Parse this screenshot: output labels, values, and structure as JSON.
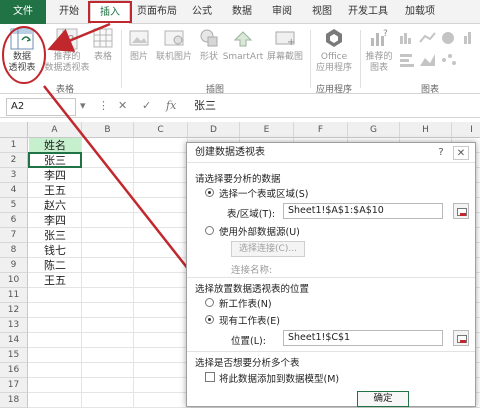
{
  "ribbon": {
    "tabs": [
      "文件",
      "开始",
      "插入",
      "页面布局",
      "公式",
      "数据",
      "审阅",
      "视图",
      "开发工具",
      "加载项"
    ],
    "buttons": {
      "pivot_table": "数据\n透视表",
      "recommended_pivot": "推荐的\n数据透视表",
      "table": "表格",
      "pictures": "图片",
      "online_pictures": "联机图片",
      "shapes": "形状",
      "smartart": "SmartArt",
      "screenshot": "屏幕截图",
      "office_apps": "Office\n应用程序",
      "recommended_charts": "推荐的\n图表"
    },
    "groups": {
      "tables": "表格",
      "illustrations": "插图",
      "apps": "应用程序",
      "charts": "图表"
    }
  },
  "formula_bar": {
    "name_box": "A2",
    "fx": "fx",
    "value": "张三"
  },
  "sheet": {
    "columns": [
      "A",
      "B",
      "C",
      "D",
      "E",
      "F",
      "G",
      "H",
      "I"
    ],
    "rows": [
      "1",
      "2",
      "3",
      "4",
      "5",
      "6",
      "7",
      "8",
      "9",
      "10",
      "11",
      "12",
      "13",
      "14",
      "15",
      "16",
      "17",
      "18"
    ],
    "column_a": [
      "姓名",
      "张三",
      "李四",
      "王五",
      "赵六",
      "李四",
      "张三",
      "钱七",
      "陈二",
      "王五"
    ]
  },
  "dialog": {
    "title": "创建数据透视表",
    "help": "?",
    "close": "✕",
    "choose_data_label": "请选择要分析的数据",
    "option_select_table": "选择一个表或区域(S)",
    "table_range_label": "表/区域(T):",
    "table_range_value": "Sheet1!$A$1:$A$10",
    "option_external": "使用外部数据源(U)",
    "choose_connection": "选择连接(C)...",
    "connection_name": "连接名称:",
    "placement_label": "选择放置数据透视表的位置",
    "option_new_sheet": "新工作表(N)",
    "option_existing_sheet": "现有工作表(E)",
    "location_label": "位置(L):",
    "location_value": "Sheet1!$C$1",
    "multi_table_label": "选择是否想要分析多个表",
    "add_to_model": "将此数据添加到数据模型(M)",
    "ok": "确定"
  },
  "colors": {
    "excel_green": "#217346",
    "annotation_red": "#c0282d",
    "header_cell_fill": "#c6efce"
  }
}
